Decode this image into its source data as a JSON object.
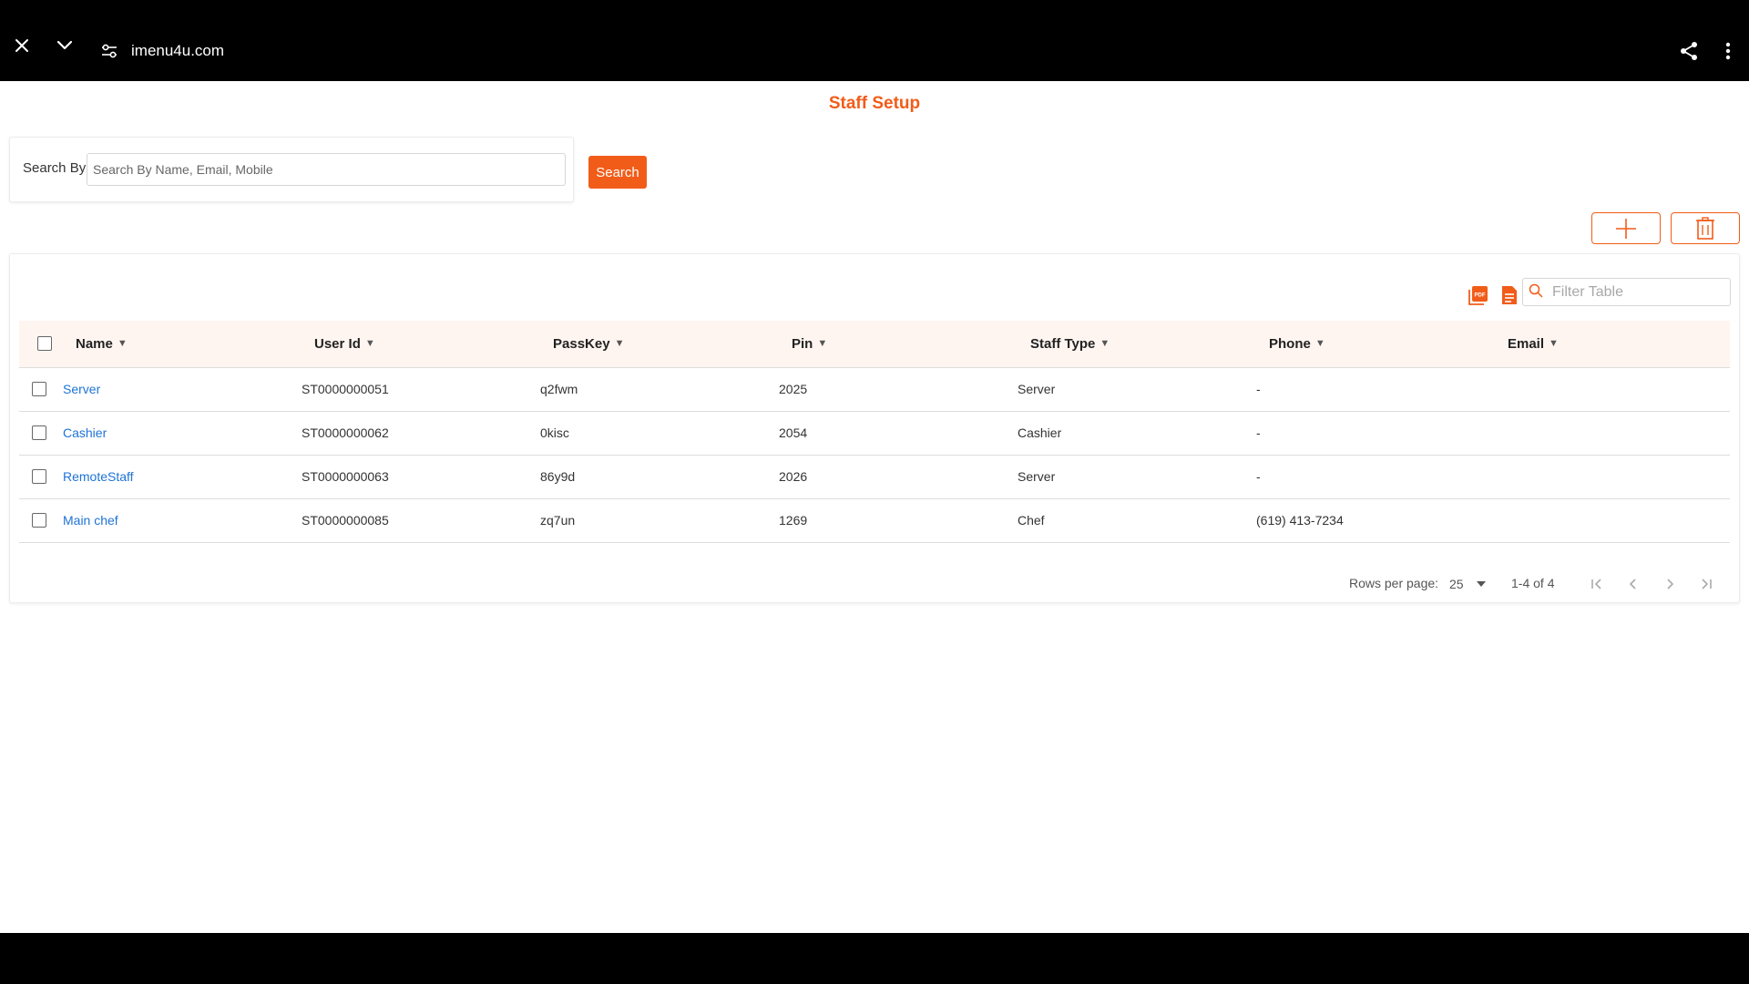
{
  "browser": {
    "url": "imenu4u.com"
  },
  "page": {
    "title": "Staff Setup"
  },
  "search": {
    "label": "Search By",
    "placeholder": "Search By Name, Email, Mobile",
    "value": "",
    "button_label": "Search"
  },
  "actions": {
    "add_icon": "plus-icon",
    "delete_icon": "trash-icon"
  },
  "table_tools": {
    "pdf_icon": "pdf-export-icon",
    "csv_icon": "document-export-icon",
    "filter_placeholder": "Filter Table"
  },
  "table": {
    "columns": [
      "Name",
      "User Id",
      "PassKey",
      "Pin",
      "Staff Type",
      "Phone",
      "Email"
    ],
    "sort_glyph": "▼",
    "rows": [
      {
        "name": "Server",
        "user_id": "ST0000000051",
        "passkey": "q2fwm",
        "pin": "2025",
        "staff_type": "Server",
        "phone": "-",
        "email": ""
      },
      {
        "name": "Cashier",
        "user_id": "ST0000000062",
        "passkey": "0kisc",
        "pin": "2054",
        "staff_type": "Cashier",
        "phone": "-",
        "email": ""
      },
      {
        "name": "RemoteStaff",
        "user_id": "ST0000000063",
        "passkey": "86y9d",
        "pin": "2026",
        "staff_type": "Server",
        "phone": "-",
        "email": ""
      },
      {
        "name": "Main chef",
        "user_id": "ST0000000085",
        "passkey": "zq7un",
        "pin": "1269",
        "staff_type": "Chef",
        "phone": "(619) 413-7234",
        "email": ""
      }
    ]
  },
  "pagination": {
    "rows_per_page_label": "Rows per page:",
    "rows_per_page": "25",
    "range": "1-4 of 4"
  },
  "colors": {
    "accent": "#f25c19",
    "link": "#1e73d6",
    "header_bg": "#fff5f0"
  }
}
